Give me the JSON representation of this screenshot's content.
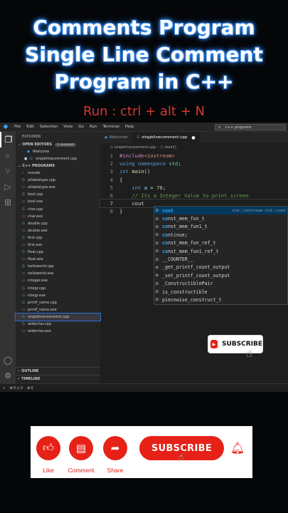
{
  "overlay": {
    "title_line1": "Comments Program",
    "title_line2": "Single Line Comment",
    "title_line3": "Program in C++",
    "shortcut": "Run : ctrl + alt + N"
  },
  "menubar": {
    "items": [
      "File",
      "Edit",
      "Selection",
      "View",
      "Go",
      "Run",
      "Terminal",
      "Help"
    ],
    "command_center": "c++ programs"
  },
  "sidebar": {
    "header": "EXPLORER",
    "open_editors_label": "OPEN EDITORS",
    "unsaved_badge": "1 unsaved",
    "open_editors": [
      "Welcome",
      "singlelinecomment.cpp"
    ],
    "folder_label": "C++ PROGRAMS",
    "files": [
      "vscode",
      "alldatatype.cpp",
      "alldatatype.exe",
      "bool.cpp",
      "bool.exe",
      "char.cpp",
      "char.exe",
      "double.cpp",
      "double.exe",
      "first.cpp",
      "first.exe",
      "float.cpp",
      "float.exe",
      "helloworld.cpp",
      "helloworld.exe",
      "integer.exe",
      "integr.cpp",
      "integr.exe",
      "printf_name.cpp",
      "printf_name.exe",
      "singlelinecomment.cpp",
      "widechar.cpp",
      "widechar.exe"
    ],
    "outline_label": "OUTLINE",
    "timeline_label": "TIMELINE"
  },
  "tabs": [
    {
      "label": "Welcome"
    },
    {
      "label": "singlelinecomment.cpp"
    }
  ],
  "breadcrumb": {
    "file": "singlelinecomment.cpp",
    "symbol": "main()"
  },
  "editor": {
    "lines": [
      {
        "n": "1",
        "tokens": [
          [
            "inc",
            "#include"
          ],
          [
            "hdr",
            "<iostream>"
          ]
        ]
      },
      {
        "n": "2",
        "tokens": [
          [
            "kw",
            "using"
          ],
          [
            "id",
            " "
          ],
          [
            "kw",
            "namespace"
          ],
          [
            "id",
            " "
          ],
          [
            "ns",
            "std"
          ],
          [
            "id",
            ";"
          ]
        ]
      },
      {
        "n": "3",
        "tokens": [
          [
            "kw",
            "int"
          ],
          [
            "id",
            " "
          ],
          [
            "fn",
            "main"
          ],
          [
            "id",
            "()"
          ]
        ]
      },
      {
        "n": "4",
        "tokens": [
          [
            "id",
            "{"
          ]
        ]
      },
      {
        "n": "5",
        "tokens": [
          [
            "id",
            "    "
          ],
          [
            "kw",
            "int"
          ],
          [
            "id",
            " "
          ],
          [
            "var",
            "a"
          ],
          [
            "id",
            " = "
          ],
          [
            "num",
            "78"
          ],
          [
            "id",
            ";"
          ]
        ]
      },
      {
        "n": "6",
        "tokens": [
          [
            "id",
            "    "
          ],
          [
            "cm",
            "// Its a Integer Value to print screen"
          ]
        ]
      },
      {
        "n": "7",
        "tokens": [
          [
            "id",
            "    "
          ],
          [
            "id",
            "cout"
          ]
        ]
      },
      {
        "n": "8",
        "tokens": [
          [
            "id",
            "}"
          ]
        ]
      }
    ]
  },
  "suggestions": [
    {
      "icon": "⊡",
      "text": "cout",
      "match": "cout",
      "detail": "std::iostream std::cout"
    },
    {
      "icon": "⊡",
      "text": "const_mem_fun_t",
      "match": "co",
      "detail": ""
    },
    {
      "icon": "⊡",
      "text": "const_mem_fun1_t",
      "match": "co",
      "detail": ""
    },
    {
      "icon": "⊡",
      "text": "continue;",
      "match": "co",
      "detail": ""
    },
    {
      "icon": "⊡",
      "text": "const_mem_fun_ref_t",
      "match": "co",
      "detail": ""
    },
    {
      "icon": "⊡",
      "text": "const_mem_fun1_ref_t",
      "match": "co",
      "detail": ""
    },
    {
      "icon": "⊡",
      "text": "__COUNTER__",
      "match": "",
      "detail": ""
    },
    {
      "icon": "⚙",
      "text": "_get_printf_count_output",
      "match": "",
      "detail": ""
    },
    {
      "icon": "⚙",
      "text": "_set_printf_count_output",
      "match": "",
      "detail": ""
    },
    {
      "icon": "⊡",
      "text": "_ConstructiblePair",
      "match": "",
      "detail": ""
    },
    {
      "icon": "⊡",
      "text": "is_constructible",
      "match": "",
      "detail": ""
    },
    {
      "icon": "⊡",
      "text": "piecewise_construct_t",
      "match": "",
      "detail": ""
    }
  ],
  "statusbar": {
    "left": "⚡",
    "errors": "⊗ 0 ⚠ 0",
    "ports": "⊕ 0"
  },
  "promo": {
    "mini_subscribe": "SUBSCRIBE",
    "like": "Like",
    "comment": "Comment",
    "share": "Share",
    "subscribe": "SUBSCRIBE"
  },
  "colors": {
    "accent_red": "#e62117",
    "title_glow": "#1f6fd6",
    "vscode_blue": "#3ca4f0"
  }
}
